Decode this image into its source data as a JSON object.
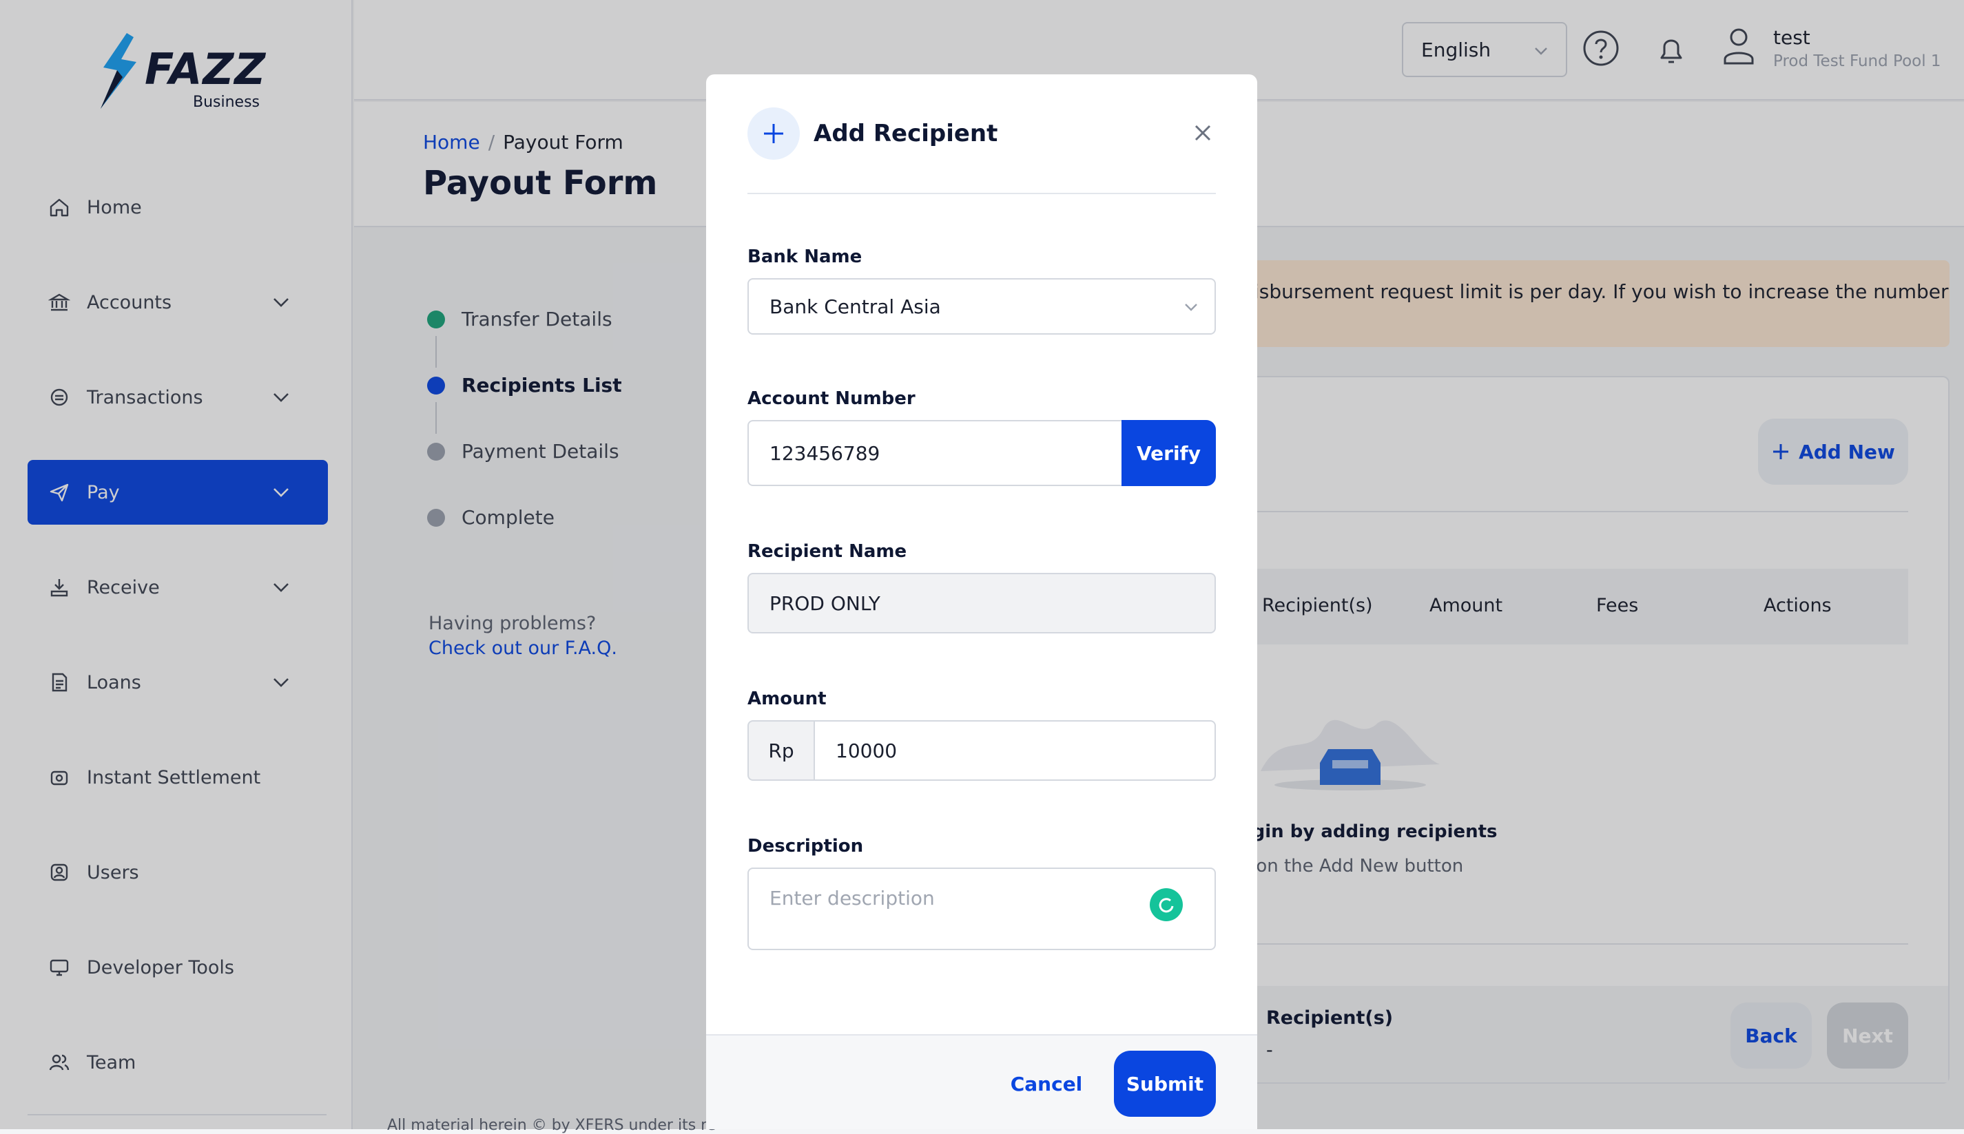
{
  "brand": {
    "name": "FAZZ",
    "sub": "Business",
    "accent": "#0a46e0",
    "logo_color": "#0e1733"
  },
  "sidebar": {
    "items": [
      {
        "label": "Home",
        "icon": "home-icon"
      },
      {
        "label": "Accounts",
        "icon": "bank-icon"
      },
      {
        "label": "Transactions",
        "icon": "transactions-icon"
      },
      {
        "label": "Pay",
        "icon": "send-icon",
        "active": true
      },
      {
        "label": "Receive",
        "icon": "receive-icon"
      },
      {
        "label": "Loans",
        "icon": "loans-icon"
      },
      {
        "label": "Instant Settlement",
        "icon": "settlement-icon"
      },
      {
        "label": "Users",
        "icon": "users-icon"
      },
      {
        "label": "Developer Tools",
        "icon": "developer-icon"
      },
      {
        "label": "Team",
        "icon": "team-icon"
      }
    ]
  },
  "header": {
    "language": "English",
    "user_name": "test",
    "user_pool": "Prod Test Fund Pool 1"
  },
  "page": {
    "breadcrumb_home": "Home",
    "breadcrumb_sep": "/",
    "breadcrumb_current": "Payout Form",
    "title": "Payout Form"
  },
  "steps": [
    {
      "label": "Transfer Details",
      "status": "done"
    },
    {
      "label": "Recipients List",
      "status": "current"
    },
    {
      "label": "Payment Details",
      "status": "pending"
    },
    {
      "label": "Complete",
      "status": "pending"
    }
  ],
  "help": {
    "question": "Having problems?",
    "link": "Check out our F.A.Q."
  },
  "background_card": {
    "notice": "isbursement request limit is per day. If you wish to increase the number of",
    "add_new": "Add New",
    "columns": [
      "Recipient(s)",
      "Amount",
      "Fees",
      "Actions"
    ],
    "empty_title": "egin by adding recipients",
    "empty_sub": "k on the Add New button",
    "footer_label": "Recipient(s)",
    "footer_value": "-",
    "back": "Back",
    "next": "Next"
  },
  "copyright": "All material herein © by XFERS under its re",
  "modal": {
    "title": "Add Recipient",
    "bank_label": "Bank Name",
    "bank_value": "Bank Central Asia",
    "account_label": "Account Number",
    "account_value": "123456789",
    "verify": "Verify",
    "recipient_label": "Recipient Name",
    "recipient_value": "PROD ONLY",
    "amount_label": "Amount",
    "currency": "Rp",
    "amount_value": "10000",
    "description_label": "Description",
    "description_placeholder": "Enter description",
    "cancel": "Cancel",
    "submit": "Submit"
  }
}
